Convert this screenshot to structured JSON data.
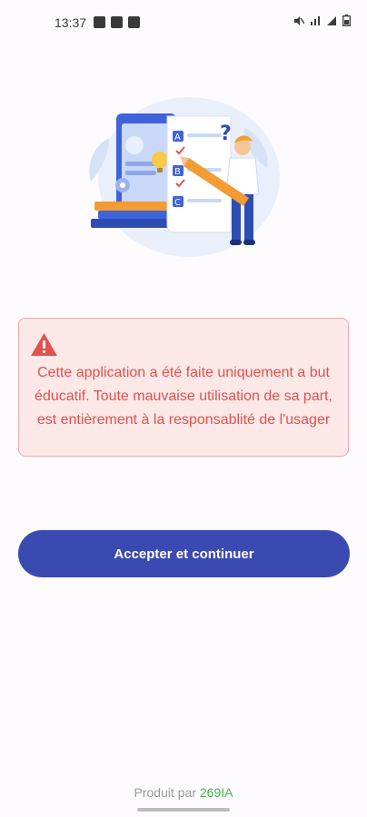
{
  "status_bar": {
    "time": "13:37",
    "left_icons": [
      "image-icon",
      "check-box-icon",
      "message-icon"
    ],
    "right_icons": [
      "mute-icon",
      "signal-4g-icon",
      "signal-icon",
      "battery-icon"
    ]
  },
  "illustration": {
    "icon": "education-quiz-illustration"
  },
  "warning": {
    "icon": "warning-icon",
    "color": "#e0524d",
    "background": "#fde8e8",
    "message": "Cette application a été faite uniquement a but éducatif. Toute mauvaise utilisation de sa part, est entièrement à la responsablité de l'usager"
  },
  "accept_button": {
    "label": "Accepter et continuer",
    "color": "#3b4ab0"
  },
  "footer": {
    "prefix": "Produit par",
    "brand": "269IA",
    "brand_color": "#4caf50"
  }
}
